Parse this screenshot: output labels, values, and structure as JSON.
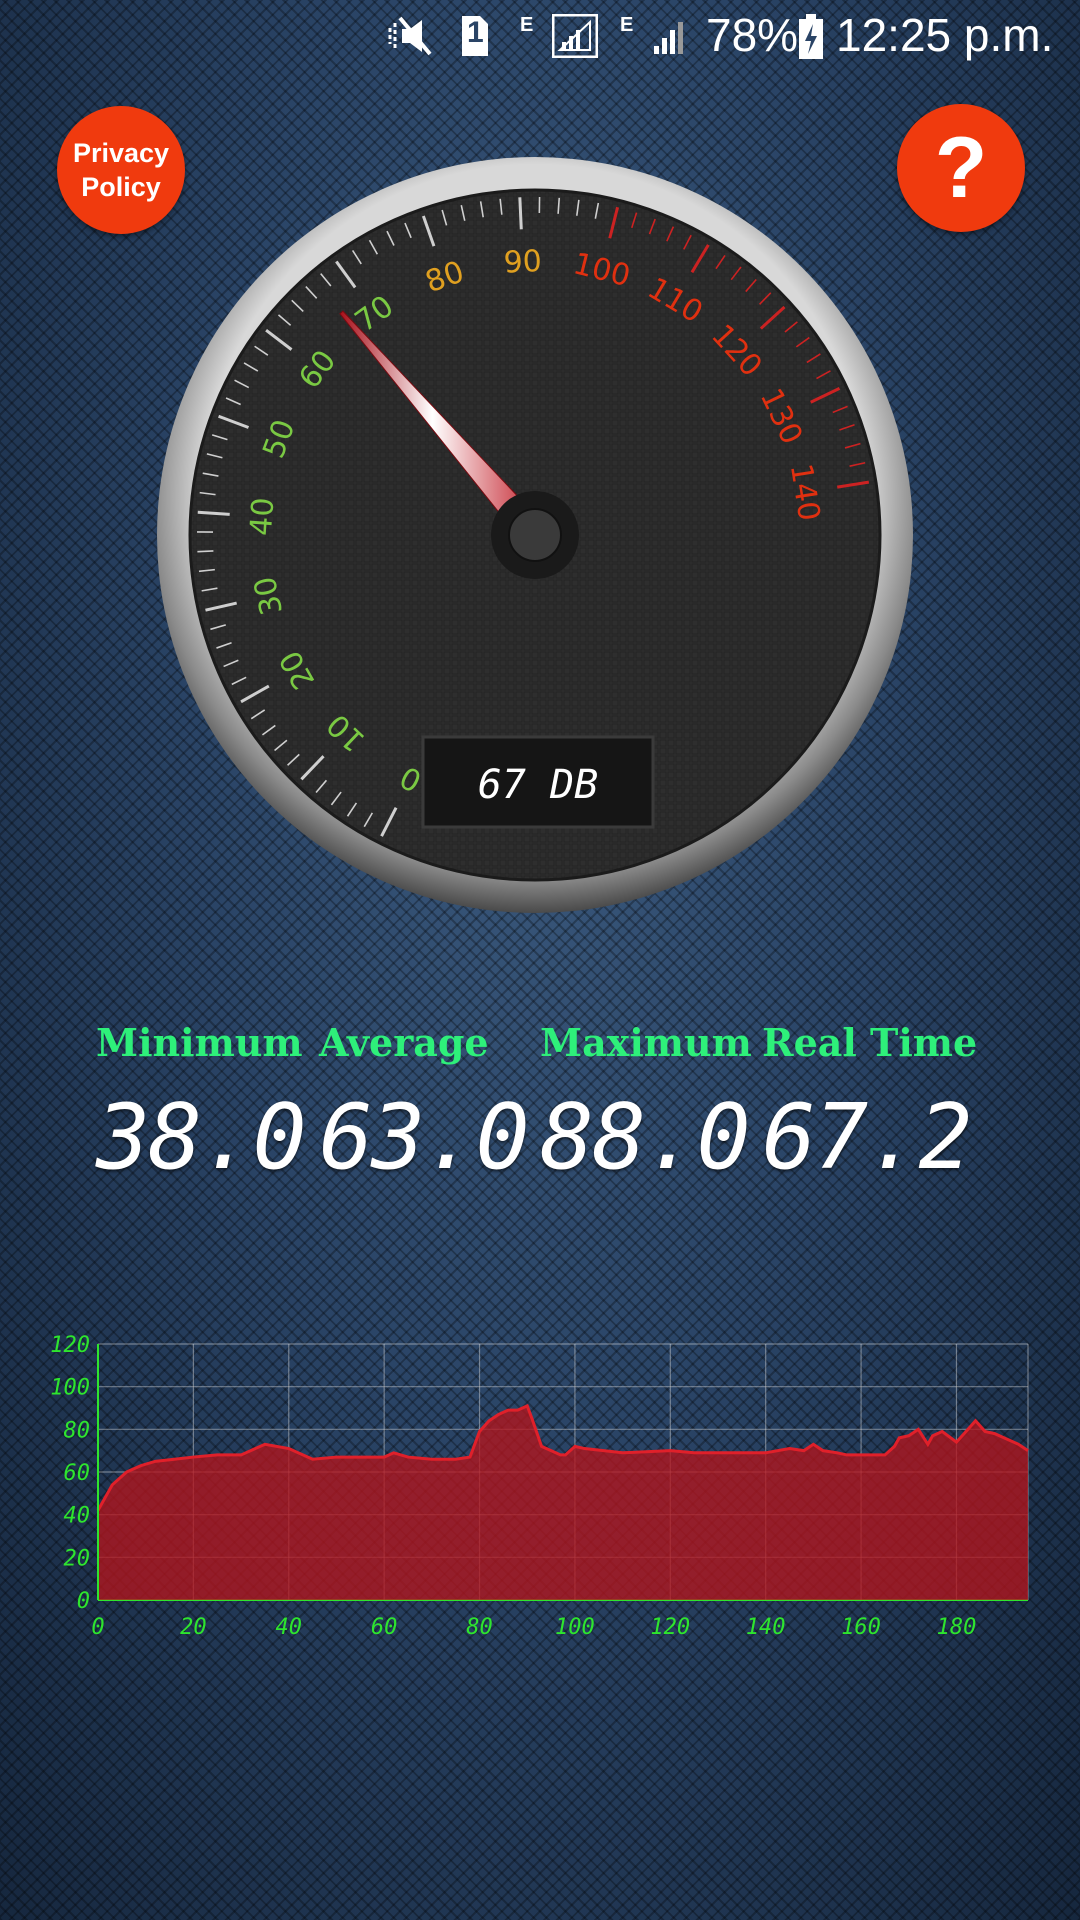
{
  "status_bar": {
    "sim_slot": "1",
    "net_type_1": "E",
    "net_type_2": "E",
    "battery": "78%",
    "time": "12:25 p.m."
  },
  "buttons": {
    "privacy_line1": "Privacy",
    "privacy_line2": "Policy",
    "help": "?"
  },
  "gauge": {
    "ticks": [
      "0",
      "10",
      "20",
      "30",
      "40",
      "50",
      "60",
      "70",
      "80",
      "90",
      "100",
      "110",
      "120",
      "130",
      "140"
    ],
    "value": 67,
    "readout": "67 DB",
    "colors": {
      "low": "#7ac943",
      "mid": "#e0a020",
      "high": "#e03010"
    }
  },
  "stats": {
    "minimum_label": "Minimum",
    "minimum_value": "38.0",
    "average_label": "Average",
    "average_value": "63.0",
    "maximum_label": "Maximum",
    "maximum_value": "88.0",
    "realtime_label": "Real Time",
    "realtime_value": "67.2"
  },
  "chart_data": {
    "type": "area",
    "x_ticks": [
      "0",
      "20",
      "40",
      "60",
      "80",
      "100",
      "120",
      "140",
      "160",
      "180"
    ],
    "y_ticks": [
      "0",
      "20",
      "40",
      "60",
      "80",
      "100",
      "120"
    ],
    "xlim": [
      0,
      195
    ],
    "ylim": [
      0,
      120
    ],
    "grid": true,
    "color": "#b3141c",
    "tick_color": "#2ee52e",
    "x": [
      0,
      3,
      6,
      9,
      12,
      16,
      20,
      25,
      30,
      35,
      40,
      45,
      50,
      55,
      60,
      62,
      65,
      70,
      75,
      78,
      80,
      82,
      84,
      86,
      88,
      90,
      91,
      93,
      95,
      97,
      98,
      100,
      102,
      110,
      120,
      125,
      130,
      140,
      145,
      148,
      150,
      152,
      155,
      157,
      160,
      165,
      167,
      168,
      170,
      172,
      174,
      175,
      177,
      180,
      182,
      184,
      186,
      188,
      190,
      193,
      195
    ],
    "y": [
      42,
      54,
      60,
      63,
      65,
      66,
      67,
      68,
      68,
      73,
      71,
      66,
      67,
      67,
      67,
      69,
      67,
      66,
      66,
      67,
      79,
      84,
      87,
      89,
      89,
      91,
      85,
      72,
      70,
      68,
      68,
      72,
      71,
      69,
      70,
      69,
      69,
      69,
      71,
      70,
      73,
      70,
      69,
      68,
      68,
      68,
      72,
      76,
      77,
      80,
      73,
      77,
      79,
      74,
      79,
      84,
      79,
      78,
      76,
      73,
      70
    ]
  }
}
